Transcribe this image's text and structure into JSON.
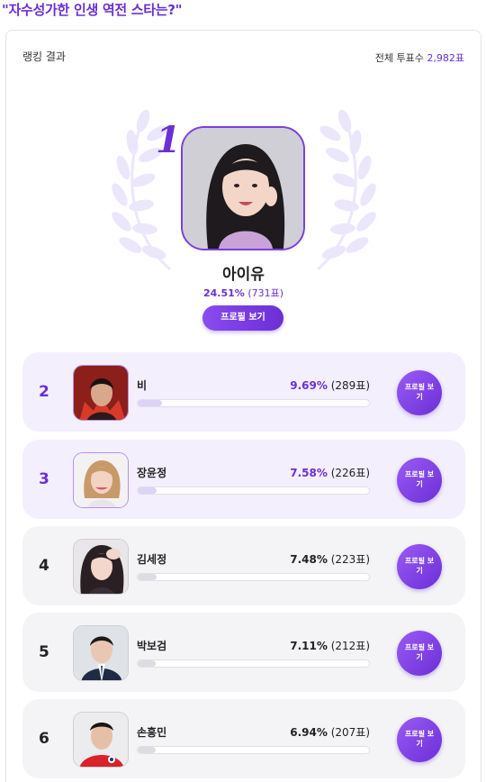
{
  "page": {
    "heading": "\"자수성가한 인생 역전 스타는?\""
  },
  "card": {
    "header_label": "랭킹 결과",
    "total_label": "전체 투표수",
    "total_count": "2,982표"
  },
  "winner": {
    "rank": "1",
    "name": "아이유",
    "percent": "24.51%",
    "votes": "(731표)",
    "profile_button": "프로필 보기"
  },
  "rankings": [
    {
      "rank": "2",
      "name": "비",
      "percent": "9.69%",
      "votes": "(289표)",
      "share": 0.0969,
      "button": "프로필 보기"
    },
    {
      "rank": "3",
      "name": "장윤정",
      "percent": "7.58%",
      "votes": "(226표)",
      "share": 0.0758,
      "button": "프로필 보기"
    },
    {
      "rank": "4",
      "name": "김세정",
      "percent": "7.48%",
      "votes": "(223표)",
      "share": 0.0748,
      "button": "프로필 보기"
    },
    {
      "rank": "5",
      "name": "박보검",
      "percent": "7.11%",
      "votes": "(212표)",
      "share": 0.0711,
      "button": "프로필 보기"
    },
    {
      "rank": "6",
      "name": "손흥민",
      "percent": "6.94%",
      "votes": "(207표)",
      "share": 0.0694,
      "button": "프로필 보기"
    }
  ],
  "colors": {
    "accent": "#6b2fd6",
    "row_top": "#f3effd",
    "row_other": "#f4f4f6"
  }
}
